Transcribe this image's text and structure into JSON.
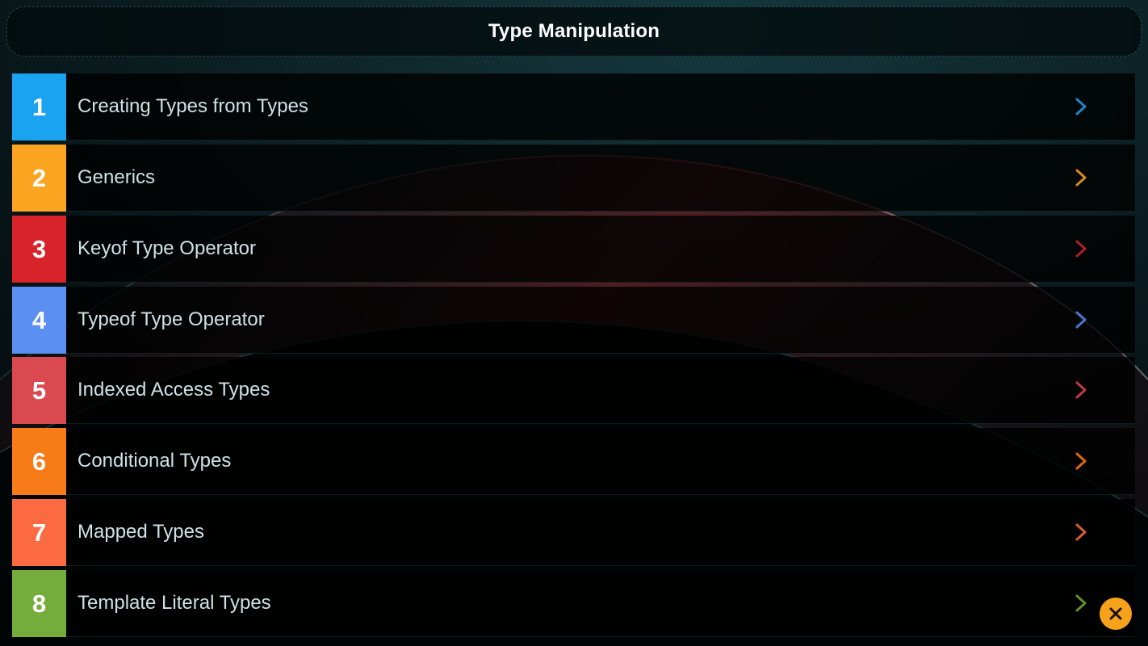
{
  "header": {
    "title": "Type Manipulation"
  },
  "items": [
    {
      "number": "1",
      "label": "Creating Types from Types",
      "color": "#1aa3f0",
      "chevron_color": "#1c86c8"
    },
    {
      "number": "2",
      "label": "Generics",
      "color": "#fba421",
      "chevron_color": "#d9881a"
    },
    {
      "number": "3",
      "label": "Keyof Type Operator",
      "color": "#d8232a",
      "chevron_color": "#b31e24"
    },
    {
      "number": "4",
      "label": "Typeof Type Operator",
      "color": "#5c8ff2",
      "chevron_color": "#4b76d0"
    },
    {
      "number": "5",
      "label": "Indexed Access Types",
      "color": "#d9494f",
      "chevron_color": "#c03a40"
    },
    {
      "number": "6",
      "label": "Conditional Types",
      "color": "#f77b17",
      "chevron_color": "#d96a12"
    },
    {
      "number": "7",
      "label": "Mapped Types",
      "color": "#fb6a40",
      "chevron_color": "#dc5a34"
    },
    {
      "number": "8",
      "label": "Template Literal Types",
      "color": "#75ad3c",
      "chevron_color": "#5f8f30"
    }
  ],
  "icons": {
    "row_chevron": "chevron-right-icon",
    "close": "close-icon"
  },
  "accent_colors": {
    "close_button": "#f7a21b"
  }
}
